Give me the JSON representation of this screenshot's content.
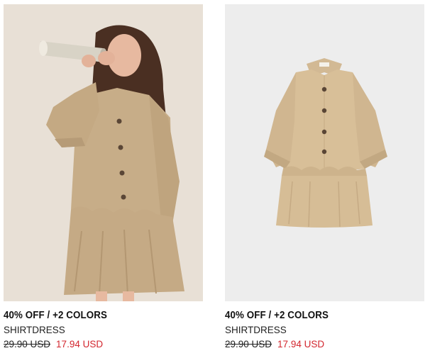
{
  "products": [
    {
      "promo": "40% OFF / +2 COLORS",
      "name": "SHIRTDRESS",
      "old_price": "29.90 USD",
      "new_price": "17.94 USD",
      "image_icon": "child-model-wearing-beige-shirtdress"
    },
    {
      "promo": "40% OFF / +2 COLORS",
      "name": "SHIRTDRESS",
      "old_price": "29.90 USD",
      "new_price": "17.94 USD",
      "image_icon": "beige-shirtdress-product-flatlay"
    }
  ],
  "colors": {
    "sale_red": "#d3272f",
    "dress_beige": "#c9b08b",
    "photo_bg_warm": "#e9e1d8",
    "photo_bg_gray": "#ececec"
  }
}
